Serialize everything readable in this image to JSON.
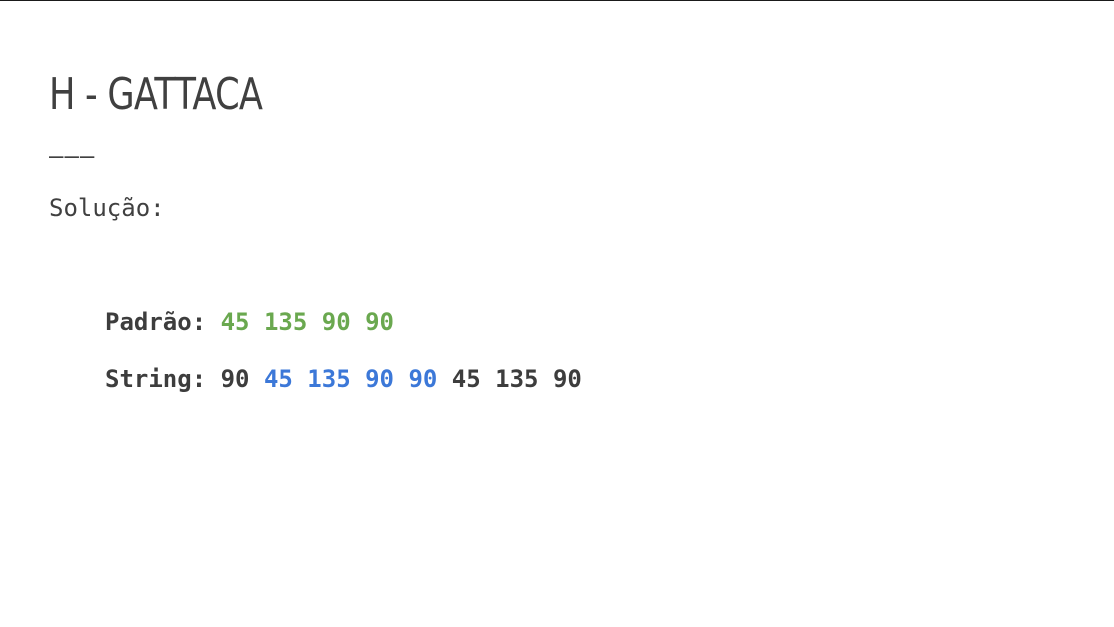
{
  "slide": {
    "title": "H - GATTACA",
    "separator": "———",
    "subtitle": "Solução:"
  },
  "pattern_line": {
    "label": "Padrão: ",
    "tokens": [
      {
        "text": "45 135 90 90",
        "color": "#6aa84f"
      }
    ]
  },
  "string_line": {
    "label": "String: ",
    "tokens": [
      {
        "text": "90 ",
        "color": "#3d3d3d"
      },
      {
        "text": "45 135 90 90",
        "color": "#3c78d8"
      },
      {
        "text": " 45 135 90",
        "color": "#3d3d3d"
      }
    ]
  },
  "colors": {
    "text": "#404040",
    "match_green": "#6aa84f",
    "match_blue": "#3c78d8"
  }
}
